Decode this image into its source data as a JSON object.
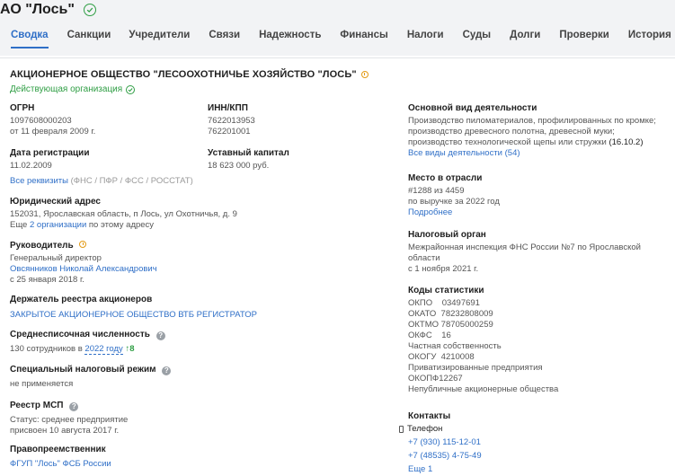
{
  "header": {
    "title": "АО \"Лось\""
  },
  "tabs": [
    {
      "label": "Сводка"
    },
    {
      "label": "Санкции"
    },
    {
      "label": "Учредители"
    },
    {
      "label": "Связи"
    },
    {
      "label": "Надежность"
    },
    {
      "label": "Финансы"
    },
    {
      "label": "Налоги"
    },
    {
      "label": "Суды"
    },
    {
      "label": "Долги"
    },
    {
      "label": "Проверки"
    },
    {
      "label": "История"
    }
  ],
  "org": {
    "full_name": "АКЦИОНЕРНОЕ ОБЩЕСТВО \"ЛЕСООХОТНИЧЬЕ ХОЗЯЙСТВО \"ЛОСЬ\"",
    "status": "Действующая организация"
  },
  "left": {
    "ogrn_label": "ОГРН",
    "ogrn": "1097608000203",
    "ogrn_date": "от 11 февраля 2009 г.",
    "inn_label": "ИНН/КПП",
    "inn": "7622013953",
    "kpp": "762201001",
    "reg_label": "Дата регистрации",
    "reg_date": "11.02.2009",
    "capital_label": "Уставный капитал",
    "capital": "18 623 000 руб.",
    "reqs_link": "Все реквизиты",
    "reqs_note": "(ФНС / ПФР / ФСС / РОССТАТ)",
    "address_label": "Юридический адрес",
    "address": "152031, Ярославская область, п Лось, ул Охотничья, д. 9",
    "address_more_prefix": "Еще",
    "address_more_link": "2 организации",
    "address_more_suffix": "по этому адресу",
    "head_label": "Руководитель",
    "head_role": "Генеральный директор",
    "head_name": "Овсянников Николай Александрович",
    "head_since": "с 25 января 2018 г.",
    "registrar_label": "Держатель реестра акционеров",
    "registrar": "ЗАКРЫТОЕ АКЦИОНЕРНОЕ ОБЩЕСТВО ВТБ РЕГИСТРАТОР",
    "staff_label": "Среднесписочная численность",
    "staff_prefix": "130 сотрудников в",
    "staff_year": "2022 году",
    "staff_delta": "↑8",
    "tax_label": "Специальный налоговый режим",
    "tax_value": "не применяется",
    "msp_label": "Реестр МСП",
    "msp_status": "Статус: среднее предприятие",
    "msp_date": "присвоен 10 августа 2017 г.",
    "pred_label": "Правопреемственник",
    "pred_link": "ФГУП \"Лось\" ФСБ России"
  },
  "right": {
    "activity_label": "Основной вид деятельности",
    "activity_text": "Производство пиломатериалов, профилированных по кромке; производство древесного полотна, древесной муки; производство технологической щепы или стружки",
    "activity_code": "(16.10.2)",
    "activity_link": "Все виды деятельности (54)",
    "rank_label": "Место в отрасли",
    "rank_value": "#1288 из 4459",
    "rank_note": "по выручке за 2022 год",
    "rank_link": "Подробнее",
    "tax_org_label": "Налоговый орган",
    "tax_org": "Межрайонная инспекция ФНС России №7 по Ярославской области",
    "tax_org_since": "с 1 ноября 2021 г.",
    "codes_label": "Коды статистики",
    "okpo": "ОКПО    03497691",
    "okato": "ОКАТО  78232808009",
    "oktmo": "ОКТМО 78705000259",
    "okfs": "ОКФС    16",
    "okfs_name": "Частная собственность",
    "okogu": "ОКОГУ  4210008",
    "okogu_name": "Приватизированные предприятия",
    "okopf": "ОКОПФ12267",
    "okopf_name": "Непубличные акционерные общества",
    "contacts_label": "Контакты",
    "phone_label": "Телефон",
    "phone1": "+7 (930) 115-12-01",
    "phone2": "+7 (48535) 4-75-49",
    "more_link": "Еще 1"
  },
  "colors": {
    "accent": "#2f6fc7",
    "green": "#2f9e44",
    "orange": "#e39b16"
  }
}
